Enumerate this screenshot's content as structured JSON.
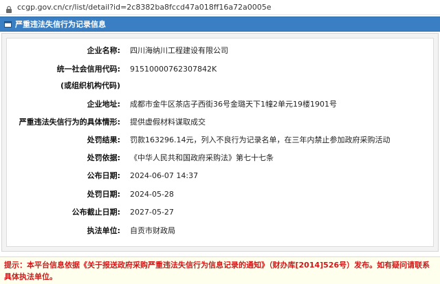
{
  "browser": {
    "url": "ccgp.gov.cn/cr/list/detail?id=2c8382ba8fccd47a018ff16a72a0005e"
  },
  "panel": {
    "title": "严重违法失信行为记录信息",
    "icon": "document-icon"
  },
  "record": {
    "rows": [
      {
        "label": "企业名称:",
        "value": "四川海纳川工程建设有限公司"
      },
      {
        "label": "统一社会信用代码:",
        "value": "91510000762307842K"
      },
      {
        "label": "(或组织机构代码)",
        "value": ""
      },
      {
        "label": "企业地址:",
        "value": "成都市金牛区茶店子西街36号金璐天下1幢2单元19楼1901号"
      },
      {
        "label": "严重违法失信行为的具体情形:",
        "value": "提供虚假材料谋取成交"
      },
      {
        "label": "处罚结果:",
        "value": "罚款163296.14元，列入不良行为记录名单，在三年内禁止参加政府采购活动"
      },
      {
        "label": "处罚依据:",
        "value": "《中华人民共和国政府采购法》第七十七条"
      },
      {
        "label": "公布日期:",
        "value": "2024-06-07 14:37"
      },
      {
        "label": "处罚日期:",
        "value": "2024-05-28"
      },
      {
        "label": "公布截止日期:",
        "value": "2027-05-27"
      },
      {
        "label": "执法单位:",
        "value": "自贡市财政局"
      }
    ]
  },
  "notice": {
    "text": "提示：本平台信息依据《关于报送政府采购严重违法失信行为信息记录的通知》（财办库[2014]526号）发布。如有疑问请联系具体执法单位。"
  },
  "colors": {
    "header_bg": "#3a7fc3",
    "notice_text": "#d01818",
    "notice_bg": "#ffffee"
  }
}
